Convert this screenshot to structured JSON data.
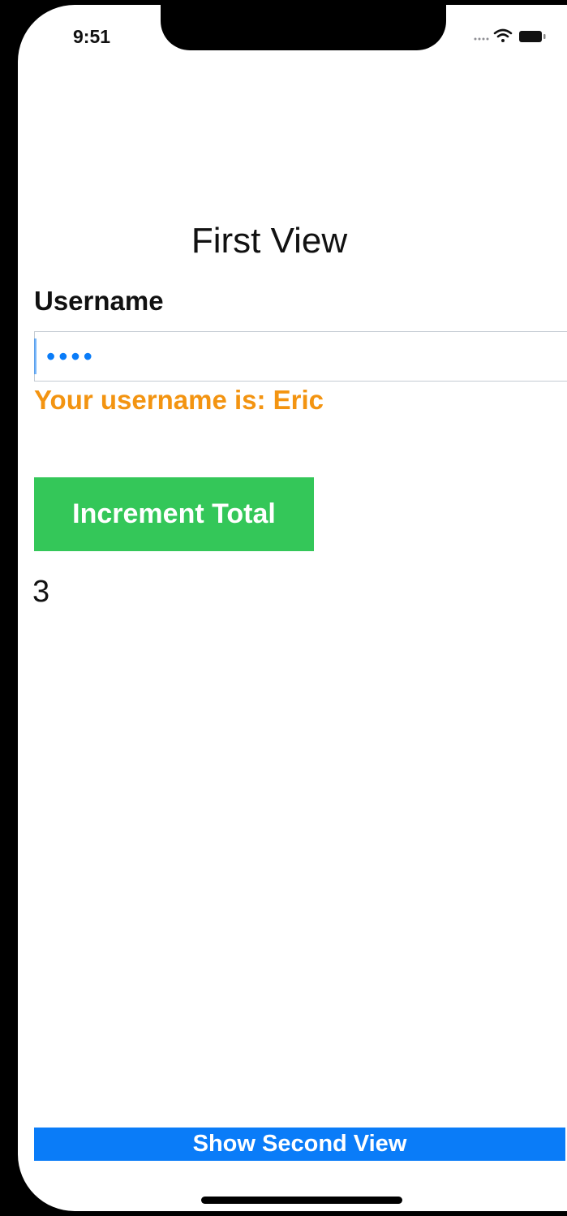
{
  "status_bar": {
    "time": "9:51",
    "icons": [
      "signal-dots-icon",
      "wifi-icon",
      "battery-icon"
    ]
  },
  "screen": {
    "title": "First View"
  },
  "username": {
    "label": "Username",
    "masked_value": "••••",
    "message": "Your username is: Eric"
  },
  "increment": {
    "button_label": "Increment Total",
    "total": "3"
  },
  "navigation": {
    "show_second_label": "Show Second View"
  },
  "colors": {
    "accent_blue": "#0a7cf8",
    "button_green": "#34c759",
    "message_orange": "#f39411"
  }
}
